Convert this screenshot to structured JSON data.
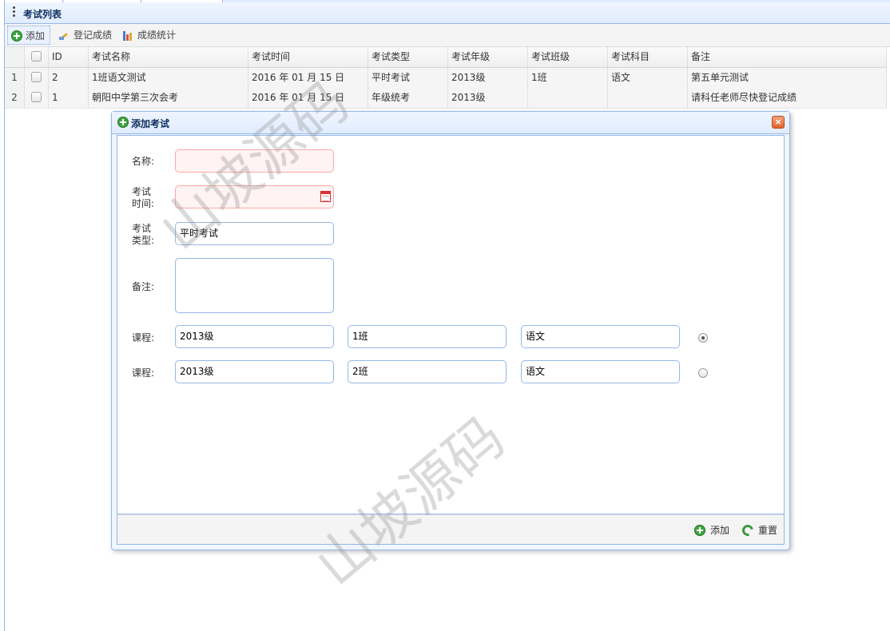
{
  "panel": {
    "title": "考试列表"
  },
  "toolbar": {
    "add_label": "添加",
    "record_label": "登记成绩",
    "stats_label": "成绩统计"
  },
  "grid": {
    "columns": [
      "ID",
      "考试名称",
      "考试时间",
      "考试类型",
      "考试年级",
      "考试班级",
      "考试科目",
      "备注"
    ],
    "rows": [
      {
        "num": "1",
        "id": "2",
        "name": "1班语文测试",
        "time": "2016 年 01 月 15 日",
        "type": "平时考试",
        "grade": "2013级",
        "class": "1班",
        "subject": "语文",
        "remark": "第五单元测试"
      },
      {
        "num": "2",
        "id": "1",
        "name": "朝阳中学第三次会考",
        "time": "2016 年 01 月 15 日",
        "type": "年级统考",
        "grade": "2013级",
        "class": "",
        "subject": "",
        "remark": "请科任老师尽快登记成绩"
      }
    ]
  },
  "dialog": {
    "title": "添加考试",
    "close_glyph": "×",
    "labels": {
      "name": "名称:",
      "time_1": "考试",
      "time_2": "时间:",
      "type_1": "考试",
      "type_2": "类型:",
      "remark": "备注:",
      "course": "课程:"
    },
    "fields": {
      "name": "",
      "time": "",
      "type": "平时考试",
      "remark": ""
    },
    "courses": [
      {
        "grade": "2013级",
        "class": "1班",
        "subject": "语文",
        "selected": true
      },
      {
        "grade": "2013级",
        "class": "2班",
        "subject": "语文",
        "selected": false
      }
    ],
    "footer": {
      "add_label": "添加",
      "reset_label": "重置"
    }
  },
  "watermark": "山坡源码",
  "colors": {
    "accent_border": "#95b8e7",
    "header_bg": "#e0ecff",
    "title_text": "#0e2d5f",
    "invalid_bg": "#fff3f3"
  }
}
